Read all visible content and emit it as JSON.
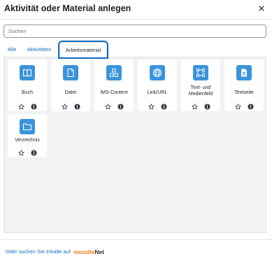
{
  "dialog": {
    "title": "Aktivität oder Material anlegen",
    "close_icon": "close-icon"
  },
  "search": {
    "placeholder": "Suchen",
    "value": ""
  },
  "tabs": [
    {
      "label": "Alle",
      "active": false
    },
    {
      "label": "Aktivitäten",
      "active": false
    },
    {
      "label": "Arbeitsmaterial",
      "active": true
    }
  ],
  "items": [
    {
      "label": "Buch",
      "icon": "book-icon"
    },
    {
      "label": "Datei",
      "icon": "file-icon"
    },
    {
      "label": "IMS-Content",
      "icon": "ims-package-icon"
    },
    {
      "label": "Link/URL",
      "icon": "globe-icon"
    },
    {
      "label": "Text- und Medienfeld",
      "icon": "text-media-area-icon"
    },
    {
      "label": "Textseite",
      "icon": "page-icon"
    },
    {
      "label": "Verzeichnis",
      "icon": "folder-icon"
    }
  ],
  "colors": {
    "accent": "#0f6cbf",
    "icon_bg": "#3a94dc",
    "panel_bg": "#f1f2f4"
  },
  "footer": {
    "text": "Oder suchen Sie Inhalte auf",
    "brand_part1": "moodle",
    "brand_part2": "Net"
  }
}
